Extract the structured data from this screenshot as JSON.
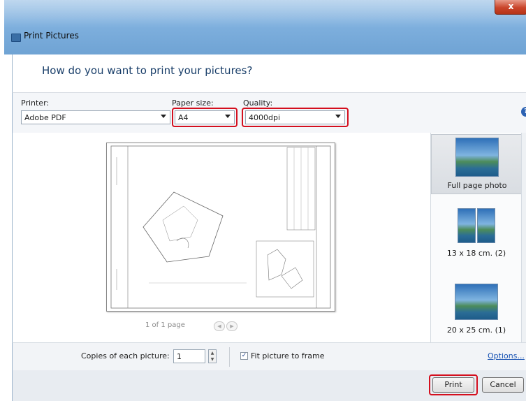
{
  "window": {
    "title": "Print Pictures",
    "close_label": "x"
  },
  "header": {
    "question": "How do you want to print your pictures?"
  },
  "options": {
    "printer_label": "Printer:",
    "printer_value": "Adobe PDF",
    "paper_size_label": "Paper size:",
    "paper_size_value": "A4",
    "quality_label": "Quality:",
    "quality_value": "4000dpi",
    "help_icon": "?"
  },
  "preview": {
    "pager_text": "1 of 1 page"
  },
  "layouts": [
    {
      "caption": "Full page photo",
      "selected": true
    },
    {
      "caption": "13 x 18 cm. (2)",
      "selected": false
    },
    {
      "caption": "20 x 25 cm. (1)",
      "selected": false
    }
  ],
  "bottom": {
    "copies_label": "Copies of each picture:",
    "copies_value": "1",
    "fit_label": "Fit picture to frame",
    "fit_checked": true,
    "options_link": "Options..."
  },
  "buttons": {
    "print_label": "Print",
    "cancel_label": "Cancel"
  },
  "colors": {
    "highlight": "#d40f1e",
    "link": "#1b55b4",
    "title_bar": "#7fb0de"
  }
}
